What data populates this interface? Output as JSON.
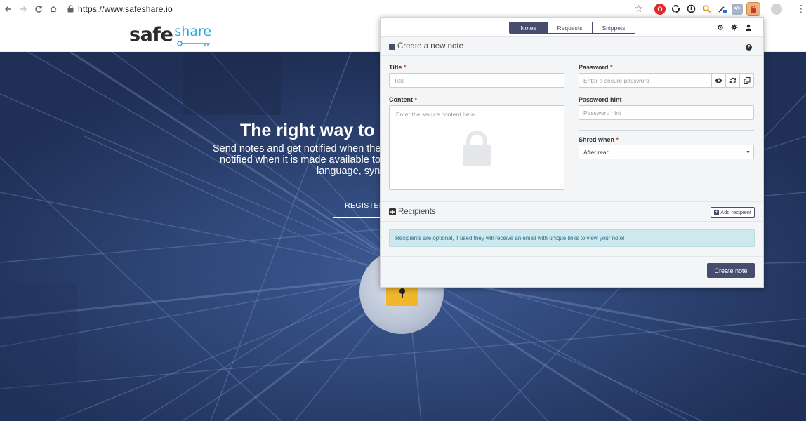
{
  "browser": {
    "url": "https://www.safeshare.io",
    "icons": [
      "back-icon",
      "forward-icon",
      "reload-icon",
      "home-icon",
      "lock-icon",
      "star-icon",
      "menu-dots-icon"
    ]
  },
  "site": {
    "logo_main": "safe",
    "logo_accent": "share",
    "hero_title": "The right way to sh",
    "hero_line1": "Send notes and get notified when they",
    "hero_line2": "notified when it is made available to",
    "hero_line3": "language, synt",
    "register_label": "REGISTER YO"
  },
  "popup": {
    "tabs": [
      {
        "label": "Notes",
        "active": true
      },
      {
        "label": "Requests",
        "active": false
      },
      {
        "label": "Snippets",
        "active": false
      }
    ],
    "create_heading": "Create a new note",
    "title_label": "Title",
    "title_placeholder": "Title",
    "content_label": "Content",
    "content_placeholder": "Enter the secure content here",
    "password_label": "Password",
    "password_placeholder": "Enter a secure password",
    "hint_label": "Password hint",
    "hint_placeholder": "Password hint",
    "shred_label": "Shred when",
    "shred_value": "After read",
    "required_mark": "*",
    "recipients_heading": "Recipients",
    "add_recipient_label": "Add recipient",
    "info_text": "Recipients are optional, if used they will receive an email with unique links to view your note!",
    "create_label": "Create note"
  },
  "colors": {
    "accent": "#474d6c",
    "logo_blue": "#29a9df",
    "hero_bg": "#2d4374",
    "info_bg": "#cde9ed",
    "required": "#c0392b"
  }
}
